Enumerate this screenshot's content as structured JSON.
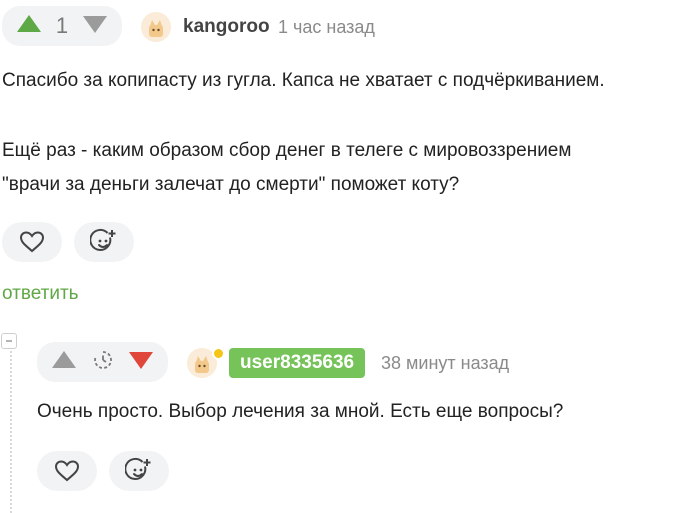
{
  "comment": {
    "vote_count": "1",
    "username": "kangoroo",
    "time": "1 час назад",
    "text_line_1": "Спасибо за копипасту из гугла. Капса не хватает с подчёркиванием.",
    "text_line_2": "Ещё раз - каким образом сбор денег в телеге с мировоззрением",
    "text_line_3": "\"врачи за деньги залечат до смерти\" поможет коту?",
    "reply_label": "ответить"
  },
  "reply": {
    "username": "user8335636",
    "time": "38 минут назад",
    "text": "Очень просто. Выбор лечения за мной. Есть еще вопросы?"
  },
  "colors": {
    "upvote_active": "#5fa846",
    "downvote_active": "#e0463a",
    "neutral_icon": "#9b9b9b",
    "username_badge": "#76c35a",
    "online_dot": "#f5c518"
  }
}
